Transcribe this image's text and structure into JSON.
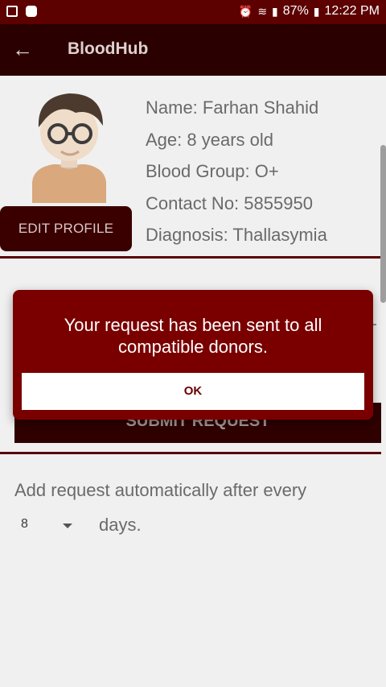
{
  "status_bar": {
    "battery": "87%",
    "time": "12:22 PM",
    "icons": [
      "gallery-icon",
      "notification-icon",
      "alarm-icon",
      "wifi-icon",
      "signal-icon",
      "battery-icon"
    ]
  },
  "app_bar": {
    "title": "BloodHub",
    "back_icon": "arrow-left-icon"
  },
  "profile": {
    "avatar_icon": "boy-avatar",
    "edit_button": "EDIT PROFILE",
    "info": [
      "Name: Farhan Shahid",
      "Age: 8 years old",
      "Blood Group: O+",
      "Contact No: 5855950",
      "Diagnosis: Thallasymia"
    ]
  },
  "submit_button": "SUBMIT REQUEST",
  "auto_request": {
    "label": "Add request automatically after every",
    "selected_days": "8",
    "suffix": "days."
  },
  "dialog": {
    "message": "Your request has been sent to all compatible donors.",
    "ok_button": "OK"
  },
  "colors": {
    "primary": "#7a0000",
    "app_bar": "#2a0000",
    "status_bar": "#5c0000",
    "background": "#f0f0f0"
  }
}
